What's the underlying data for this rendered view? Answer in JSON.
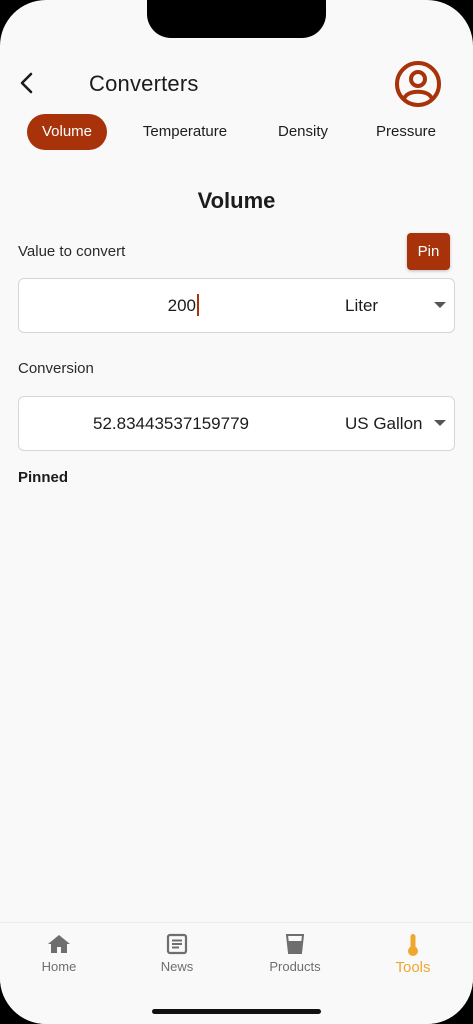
{
  "header": {
    "title": "Converters"
  },
  "tabs": [
    {
      "label": "Volume",
      "active": true
    },
    {
      "label": "Temperature",
      "active": false
    },
    {
      "label": "Density",
      "active": false
    },
    {
      "label": "Pressure",
      "active": false
    }
  ],
  "main": {
    "section_title": "Volume",
    "input_label": "Value to convert",
    "pin_label": "Pin",
    "input_value": "200",
    "input_unit": "Liter",
    "conversion_label": "Conversion",
    "conversion_value": "52.83443537159779",
    "conversion_unit": "US Gallon",
    "pinned_title": "Pinned"
  },
  "bottom_nav": [
    {
      "label": "Home",
      "icon": "home-icon",
      "active": false
    },
    {
      "label": "News",
      "icon": "news-icon",
      "active": false
    },
    {
      "label": "Products",
      "icon": "glass-icon",
      "active": false
    },
    {
      "label": "Tools",
      "icon": "thermometer-icon",
      "active": true
    }
  ],
  "colors": {
    "accent": "#a8330a",
    "active_nav": "#efa82f",
    "background": "#f9f9f9"
  }
}
